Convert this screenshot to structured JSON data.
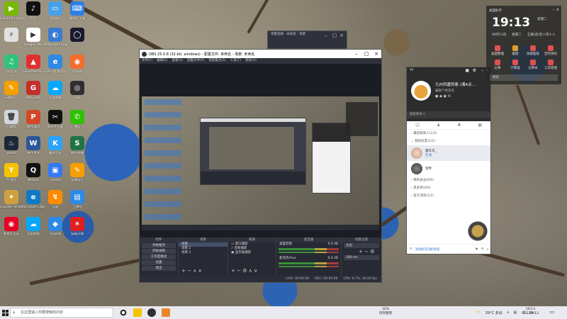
{
  "desktop": {
    "icons": [
      {
        "label": "GeForce Experience",
        "color": "#76b900",
        "glyph": "▶"
      },
      {
        "label": "抖音",
        "color": "#111111",
        "glyph": "♪"
      },
      {
        "label": "此电脑",
        "color": "#4aa0e6",
        "glyph": "▭"
      },
      {
        "label": "金山打字通",
        "color": "#2f7ee6",
        "glyph": "⌨"
      },
      {
        "label": "",
        "color": "#e0e0e0",
        "glyph": "⚡"
      },
      {
        "label": "Google Play",
        "color": "#ffffff",
        "glyph": "▶"
      },
      {
        "label": "Wallpaper Engine",
        "color": "#3a7bd5",
        "glyph": "◐"
      },
      {
        "label": "",
        "color": "#1a1a2e",
        "glyph": "◯"
      },
      {
        "label": "QQ音乐",
        "color": "#31c27c",
        "glyph": "♫"
      },
      {
        "label": "LauncherPa...",
        "color": "#e03030",
        "glyph": "▲"
      },
      {
        "label": "2345 加速浏览器",
        "color": "#2e89e5",
        "glyph": "e"
      },
      {
        "label": "Origin",
        "color": "#f56c2d",
        "glyph": "◉"
      },
      {
        "label": "乐教乐学",
        "color": "#f59f00",
        "glyph": "✎"
      },
      {
        "label": "WeGame",
        "color": "#c4302b",
        "glyph": "G"
      },
      {
        "label": "百度网盘",
        "color": "#06a7ff",
        "glyph": "☁"
      },
      {
        "label": "OBS",
        "color": "#302e31",
        "glyph": "◎"
      },
      {
        "label": "回收站",
        "color": "#cfd8dc",
        "glyph": "🗑"
      },
      {
        "label": "WPS演示",
        "color": "#d24726",
        "glyph": "P"
      },
      {
        "label": "剪映专业版",
        "color": "#111111",
        "glyph": "✂"
      },
      {
        "label": "微信",
        "color": "#2dc100",
        "glyph": "✆"
      },
      {
        "label": "Steam",
        "color": "#1b2838",
        "glyph": "♨"
      },
      {
        "label": "WPS文字",
        "color": "#2b579a",
        "glyph": "W"
      },
      {
        "label": "酷狗音乐",
        "color": "#2ca2f9",
        "glyph": "K"
      },
      {
        "label": "WPS表格",
        "color": "#217346",
        "glyph": "S"
      },
      {
        "label": "YY语音",
        "color": "#f5c400",
        "glyph": "Y"
      },
      {
        "label": "腾讯QQ",
        "color": "#111111",
        "glyph": "Q"
      },
      {
        "label": "ToDesk",
        "color": "#3478f6",
        "glyph": "▣"
      },
      {
        "label": "乐教乐学",
        "color": "#f59f00",
        "glyph": "✎"
      },
      {
        "label": "Counter-Strike Global Off...",
        "color": "#d0a040",
        "glyph": "✦"
      },
      {
        "label": "Microsoft Edge",
        "color": "#0f7ac6",
        "glyph": "e"
      },
      {
        "label": "迅雷",
        "color": "#ff8c00",
        "glyph": "↯"
      },
      {
        "label": "上课吧",
        "color": "#2e89e5",
        "glyph": "▤"
      },
      {
        "label": "网易云音乐",
        "color": "#e60026",
        "glyph": "◉"
      },
      {
        "label": "百度网盘",
        "color": "#06a7ff",
        "glyph": "☁"
      },
      {
        "label": "QQ游戏",
        "color": "#2e89e5",
        "glyph": "◆"
      },
      {
        "label": "穿越火线",
        "color": "#e02020",
        "glyph": "✶"
      }
    ]
  },
  "bg_window": {
    "title": "场景选择 · 未命名 · 场景"
  },
  "obs": {
    "title": "OBS 25.0.8 (32-bit, windows) - 配置文件: 未命名 - 场景: 未命名",
    "menu": [
      "文件(F)",
      "编辑(E)",
      "查看(V)",
      "配置文件(P)",
      "场景集合(S)",
      "工具(T)",
      "帮助(H)"
    ],
    "docks": {
      "controls_header": "控件",
      "scenes_header": "场景",
      "sources_header": "来源",
      "mixer_header": "混音器",
      "transitions_header": "场景过渡",
      "controls": [
        "开始推流",
        "开始录制",
        "工作室模式",
        "设置",
        "退出"
      ],
      "scenes": [
        "场景",
        "场景 2",
        "场景 3"
      ],
      "sources": [
        "窗口捕获",
        "音频捕获",
        "显示器捕获"
      ],
      "mixer": [
        {
          "name": "桌面音频",
          "level": "0.0 dB"
        },
        {
          "name": "麦克风/Aux",
          "level": "0.0 dB"
        }
      ],
      "transition": "淡出",
      "duration": "300 ms"
    },
    "status": [
      "LIVE: 00:00:00",
      "REC: 00:00:00",
      "CPU: 0.7%, 30.00 fps"
    ]
  },
  "yy": {
    "title": "YY",
    "name": "九州风雷剑客 (湘A点...",
    "signature": "编辑个性签名",
    "search_placeholder": "搜索联系人",
    "groups": [
      {
        "label": "最近联系人(1/2)"
      },
      {
        "label": "我的好友(1/2)"
      },
      {
        "label": "我的关注(0/0)"
      },
      {
        "label": "黑名单(0/0)"
      },
      {
        "label": "官方消息(1/2)"
      }
    ],
    "contacts": [
      {
        "name": "嘉年华_",
        "status": "在线"
      },
      {
        "name": "望帝",
        "status": ""
      }
    ],
    "bottom_label": "添加好友/群/频道"
  },
  "clock_widget": {
    "title": "桌面助手",
    "time": "19:13",
    "date": "09月13日",
    "weekday": "星期二",
    "lunar": "壬寅(虎)年八月十八",
    "tools": [
      {
        "label": "桌面整理",
        "color": "#e05050"
      },
      {
        "label": "截图",
        "color": "#e0a030"
      },
      {
        "label": "快捷面板",
        "color": "#e05050"
      },
      {
        "label": "定时关机",
        "color": "#e05050"
      },
      {
        "label": "记事",
        "color": "#e05050"
      },
      {
        "label": "计算器",
        "color": "#e05050"
      },
      {
        "label": "记事本",
        "color": "#e05050"
      },
      {
        "label": "工具管理",
        "color": "#e05050"
      }
    ],
    "search_placeholder": "搜索"
  },
  "taskbar": {
    "search_placeholder": "在这里输入你要搜索的内容",
    "perf_value": "32%",
    "perf_label": "内存使用",
    "weather": "29°C 多云",
    "ime": "中",
    "time": "19:13",
    "date": "2022/9/13"
  }
}
